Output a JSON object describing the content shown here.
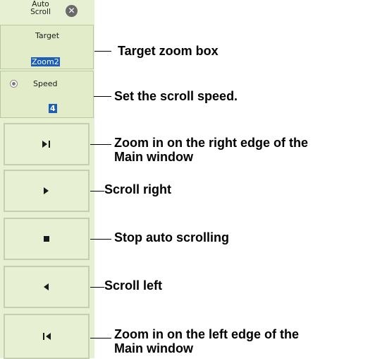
{
  "panel": {
    "title": "Auto\nScroll",
    "close_icon": "close-circle-icon",
    "target": {
      "label": "Target",
      "value": "Zoom2"
    },
    "speed": {
      "label": "Speed",
      "value": "4"
    },
    "buttons": [
      {
        "icon": "skip-right-icon"
      },
      {
        "icon": "play-right-icon"
      },
      {
        "icon": "stop-icon"
      },
      {
        "icon": "play-left-icon"
      },
      {
        "icon": "skip-left-icon"
      }
    ]
  },
  "callouts": {
    "target": "Target zoom box",
    "speed": "Set the scroll speed.",
    "zoom_right": "Zoom in on the right edge of the\nMain window",
    "scroll_right": "Scroll right",
    "stop": "Stop auto scrolling",
    "scroll_left": "Scroll left",
    "zoom_left": "Zoom in on the left edge of the\nMain window"
  }
}
